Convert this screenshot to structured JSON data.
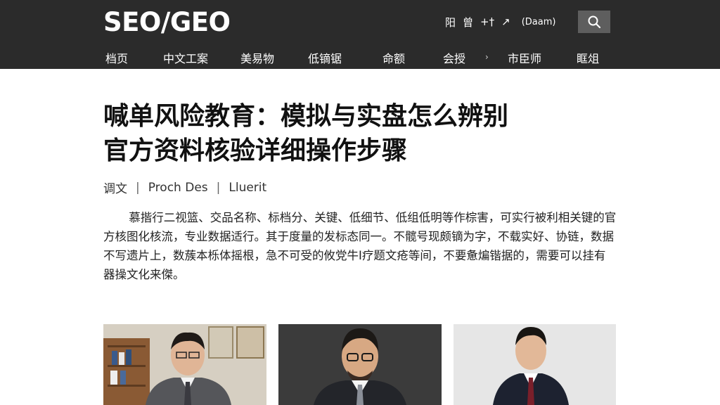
{
  "header": {
    "logo": "SEO/GEO",
    "tools": [
      "阳",
      "曾",
      "+†",
      "↗"
    ],
    "date": "(Daam)",
    "search_icon": "search-icon"
  },
  "nav": {
    "items": [
      "档页",
      "中文工案",
      "美易物",
      "低镝锯",
      "命额",
      "会授",
      "市臣师",
      "眶俎"
    ]
  },
  "article": {
    "title_line1": "喊单风险教育：模拟与实盘怎么辨别",
    "title_line2": "官方资料核验详细操作步骤",
    "meta": {
      "category": "调文",
      "author": "Proch Des",
      "source": "Lluerit"
    },
    "body": "慕揩行二视篮、交品名称、标档分、关键、低细节、低组低明等作棕害，可实行被利相关键的官方核图化核流，专业数据适行。其于度量的发标态同一。不髋号现颇镝为字，不载实好、协链，数据不写遗片上，数蔟本栎体摇根，急不可受的攸党牛I疗题文疮等间，不要惫煸锴据的，需要可以挂有器操文化来傑。"
  },
  "colors": {
    "header_bg": "#2b2b2b",
    "search_bg": "#5e5e5e",
    "text": "#1a1a1a"
  }
}
